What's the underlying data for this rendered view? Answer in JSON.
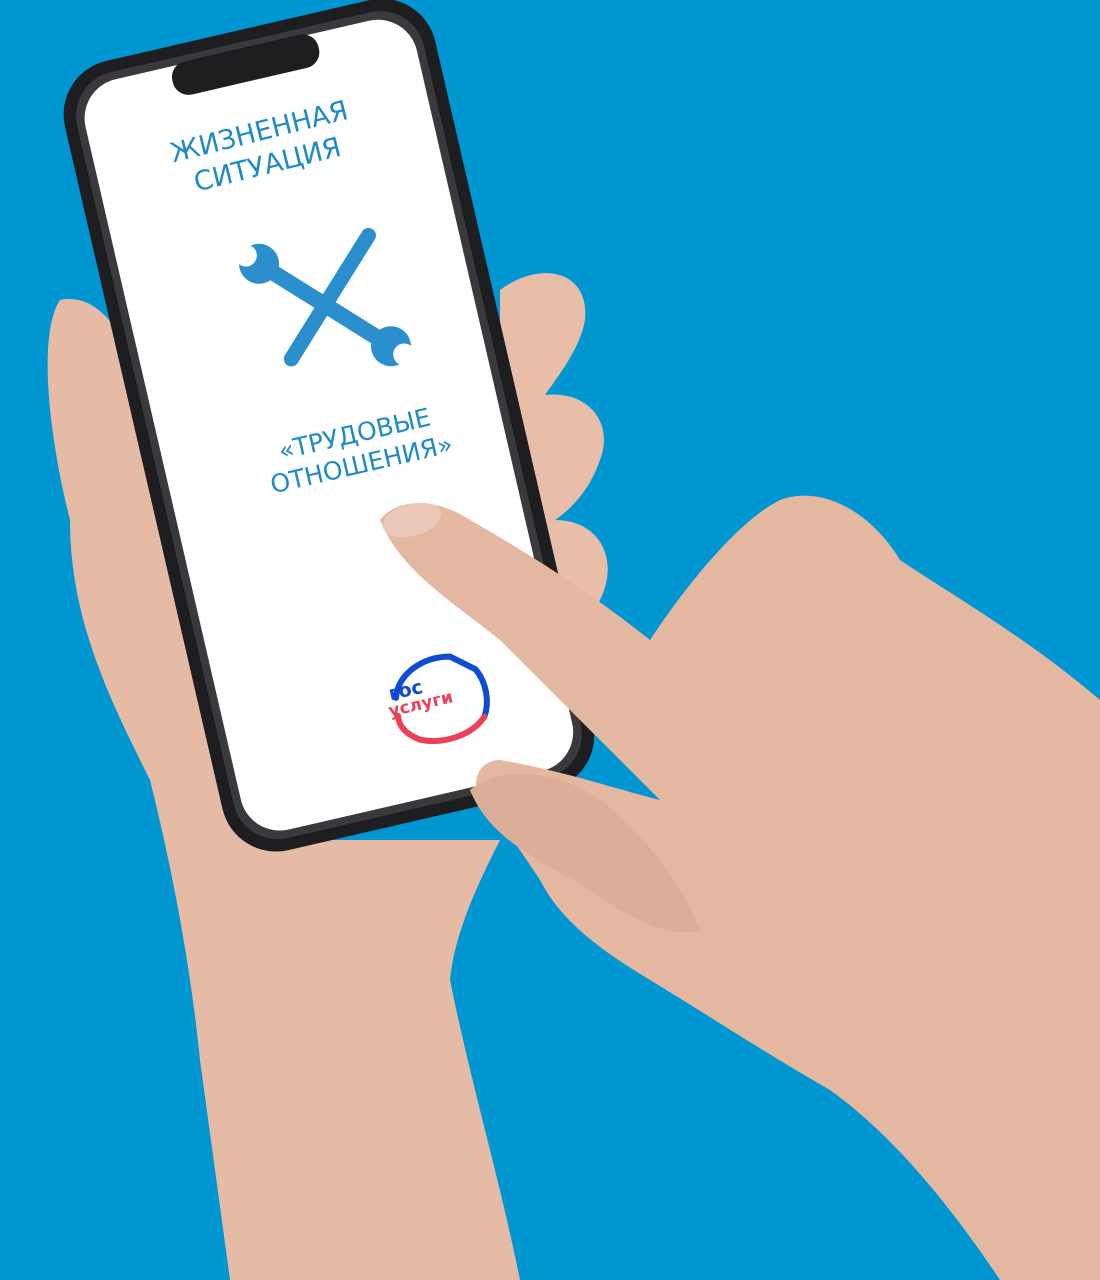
{
  "screen": {
    "headline": [
      "ЖИЗНЕННАЯ",
      "СИТУАЦИЯ"
    ],
    "topic": [
      "«ТРУДОВЫЕ",
      "ОТНОШЕНИЯ»"
    ],
    "icon": "wrench-screwdriver-icon"
  },
  "logo": {
    "top": "гос",
    "bottom": "услуги"
  },
  "colors": {
    "background": "#0096d2",
    "screen_text": "#1e8ac6",
    "logo_blue": "#0d4cd3",
    "logo_red": "#ee3f58"
  }
}
